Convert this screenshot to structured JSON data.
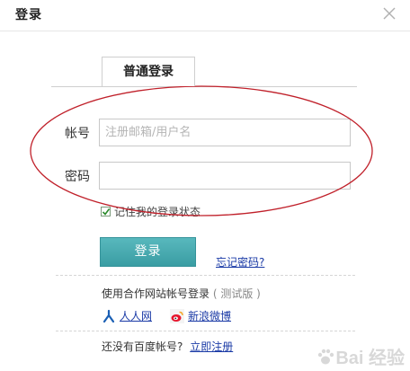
{
  "dialog": {
    "title": "登录",
    "close_icon": "close-icon"
  },
  "tab": {
    "label": "普通登录"
  },
  "form": {
    "account_label": "帐号",
    "account_placeholder": "注册邮箱/用户名",
    "account_value": "",
    "password_label": "密码",
    "password_value": "",
    "remember_label": "记住我的登录状态",
    "remember_checked": true,
    "login_button": "登录",
    "forgot_link": "忘记密码?"
  },
  "partners": {
    "prompt": "使用合作网站帐号登录",
    "note": "( 测试版 )",
    "items": [
      {
        "label": "人人网",
        "icon": "renren-icon",
        "color": "#1a5fb4"
      },
      {
        "label": "新浪微博",
        "icon": "sina-weibo-icon",
        "color": "#e6162d"
      }
    ]
  },
  "register": {
    "prompt": "还没有百度帐号?",
    "link": "立即注册"
  },
  "annotation": {
    "color": "#c0202a"
  },
  "watermark": {
    "text": "Bai 经验"
  }
}
